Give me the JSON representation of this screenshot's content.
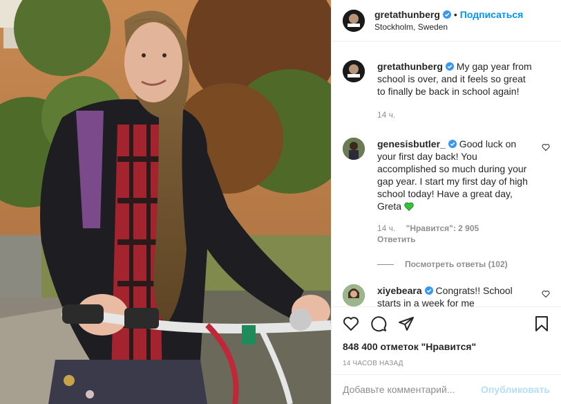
{
  "post": {
    "photo_alt": "Greta Thunberg with bicycle",
    "header": {
      "username": "gretathunberg",
      "separator": "•",
      "follow_label": "Подписаться",
      "location": "Stockholm, Sweden"
    },
    "caption": {
      "username": "gretathunberg",
      "text": "My gap year from school is over, and it feels so great to finally be back in school again!",
      "time": "14 ч."
    },
    "comments": [
      {
        "username": "genesisbutler_",
        "text": "Good luck on your first day back! You accomplished so much during your gap year. I start my first day of high school today! Have a great day, Greta",
        "time": "14 ч.",
        "likes": "\"Нравится\": 2 905",
        "reply_label": "Ответить"
      },
      {
        "username": "xiyebeara",
        "text": "Congrats!! School starts in a week for me"
      }
    ],
    "view_replies_label": "Посмотреть ответы (102)",
    "likes_label": "848 400 отметок \"Нравится\"",
    "timestamp": "14 часов назад",
    "add_comment_placeholder": "Добавьте комментарий...",
    "publish_label": "Опубликовать",
    "icons": {
      "like": "heart-icon",
      "comment": "comment-icon",
      "share": "share-icon",
      "save": "bookmark-icon",
      "verified": "verified-badge-icon"
    },
    "colors": {
      "accent": "#0095f6",
      "verified": "#3897f0",
      "publish_disabled": "#b2dffc",
      "muted": "#8e8e8e",
      "text": "#262626"
    }
  }
}
